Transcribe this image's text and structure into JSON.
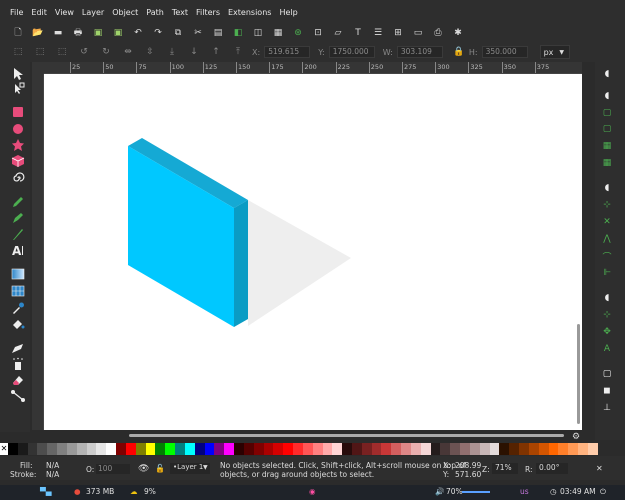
{
  "menu": [
    "File",
    "Edit",
    "View",
    "Layer",
    "Object",
    "Path",
    "Text",
    "Filters",
    "Extensions",
    "Help"
  ],
  "controls": {
    "x_label": "X:",
    "x_value": "519.615",
    "y_label": "Y:",
    "y_value": "1750.000",
    "w_label": "W:",
    "w_value": "303.109",
    "h_label": "H:",
    "h_value": "350.000",
    "unit": "px"
  },
  "ruler": [
    "25",
    "50",
    "75",
    "100",
    "125",
    "150",
    "175",
    "200",
    "225",
    "250",
    "275",
    "300",
    "325",
    "350",
    "375"
  ],
  "drawing": {
    "face_color": "#00c8ff",
    "side_color": "#0a9cc4",
    "top_color": "#15a9d4",
    "shadow_color": "#eeeeee"
  },
  "status": {
    "fill_label": "Fill:",
    "fill_value": "N/A",
    "stroke_label": "Stroke:",
    "stroke_value": "N/A",
    "opacity_label": "O:",
    "opacity_value": "100",
    "layer": "•Layer 1",
    "message_line1": "No objects selected. Click, Shift+click, Alt+scroll mouse on top of",
    "message_line2": "objects, or drag around objects to select.",
    "cursor_x_label": "X:",
    "cursor_x": "208.99",
    "cursor_y_label": "Y:",
    "cursor_y": "571.60",
    "zoom_label": "Z:",
    "zoom": "71%",
    "rotation_label": "R:",
    "rotation": "0.00°"
  },
  "taskbar": {
    "memory": "373 MB",
    "cpu": "9%",
    "volume": "70%",
    "keyboard": "us",
    "time": "03:49 AM"
  },
  "palette_colors": [
    "#000000",
    "#1a1a1a",
    "#333333",
    "#4d4d4d",
    "#666666",
    "#808080",
    "#999999",
    "#b3b3b3",
    "#cccccc",
    "#e6e6e6",
    "#ffffff",
    "#800000",
    "#ff0000",
    "#808000",
    "#ffff00",
    "#008000",
    "#00ff00",
    "#008080",
    "#00ffff",
    "#000080",
    "#0000ff",
    "#800080",
    "#ff00ff",
    "#2b0000",
    "#550000",
    "#800000",
    "#aa0000",
    "#d40000",
    "#ff0000",
    "#ff2a2a",
    "#ff5555",
    "#ff8080",
    "#ffaaaa",
    "#ffd5d5",
    "#280b0b",
    "#501616",
    "#782121",
    "#a02c2c",
    "#c83737",
    "#d35f5f",
    "#de8787",
    "#e9afaf",
    "#f4d7d7",
    "#241c1c",
    "#483737",
    "#6c5353",
    "#916f6f",
    "#ac9393",
    "#c8b7b7",
    "#e3dbdb",
    "#2b1100",
    "#552200",
    "#803300",
    "#aa4400",
    "#d45500",
    "#ff6600",
    "#ff7f2a",
    "#ff9955",
    "#ffb380",
    "#ffccaa"
  ]
}
